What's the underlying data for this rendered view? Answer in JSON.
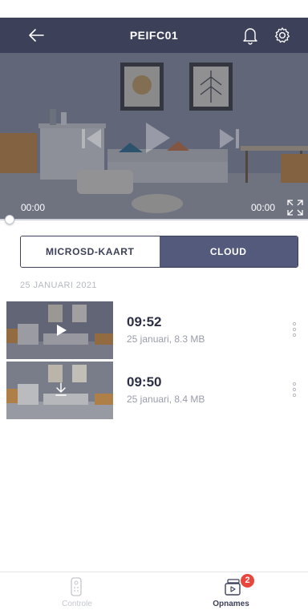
{
  "header": {
    "title": "PEIFC01",
    "back_icon": "arrow-left-icon",
    "bell_icon": "bell-icon",
    "settings_icon": "gear-icon",
    "background": "#3d4059"
  },
  "player": {
    "time_elapsed": "00:00",
    "time_total": "00:00",
    "progress": 0
  },
  "source_tabs": {
    "options": [
      "MICROSD-KAART",
      "CLOUD"
    ],
    "selected": "CLOUD",
    "active_color": "#535a7c"
  },
  "recordings": {
    "date_header": "25 JANUARI 2021",
    "items": [
      {
        "time": "09:52",
        "meta": "25 januari, 8.3 MB",
        "thumb_icon": "play-icon"
      },
      {
        "time": "09:50",
        "meta": "25 januari, 8.4 MB",
        "thumb_icon": "download-icon"
      }
    ]
  },
  "tabbar": {
    "tabs": [
      {
        "label": "Controle",
        "icon": "remote-icon",
        "active": false
      },
      {
        "label": "Opnames",
        "icon": "recordings-icon",
        "active": true,
        "badge": "2"
      }
    ],
    "badge_color": "#e8453c"
  }
}
